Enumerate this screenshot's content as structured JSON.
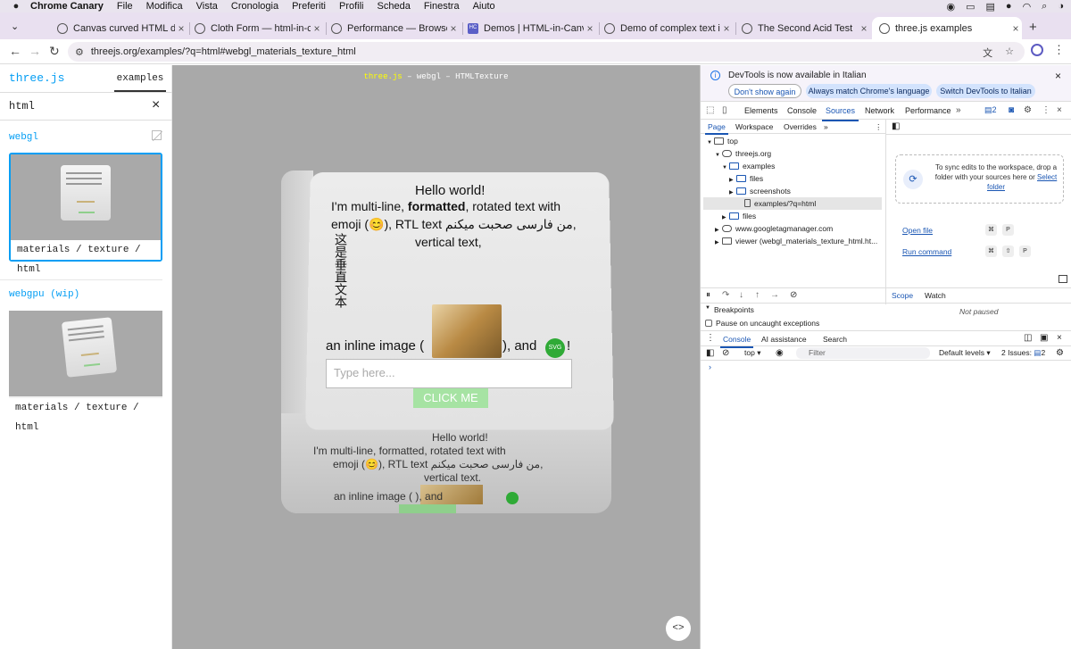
{
  "menubar": {
    "app": "Chrome Canary",
    "items": [
      "File",
      "Modifica",
      "Vista",
      "Cronologia",
      "Preferiti",
      "Profili",
      "Scheda",
      "Finestra",
      "Aiuto"
    ]
  },
  "tabs": [
    {
      "title": "Canvas curved HTML demo",
      "icon": "globe-icon"
    },
    {
      "title": "Cloth Form — html-in-canvas",
      "icon": "globe-icon"
    },
    {
      "title": "Performance — Browser Native",
      "icon": "globe-icon"
    },
    {
      "title": "Demos | HTML-in-Canvas",
      "icon": "hc-icon",
      "icon_text": "HC"
    },
    {
      "title": "Demo of complex text in canvas",
      "icon": "globe-icon"
    },
    {
      "title": "The Second Acid Test",
      "icon": "globe-icon"
    },
    {
      "title": "three.js examples",
      "icon": "globe-icon",
      "active": true
    }
  ],
  "address_bar": {
    "url": "threejs.org/examples/?q=html#webgl_materials_texture_html"
  },
  "sidebar": {
    "logo": "three.js",
    "tab_label": "examples",
    "search_value": "html",
    "categories": [
      {
        "name": "webgl",
        "example": "materials / texture / html",
        "selected": true
      },
      {
        "name": "webgpu (wip)",
        "example": "materials / texture / html",
        "selected": false
      }
    ]
  },
  "viewport": {
    "title_link": "three.js",
    "title_rest": " – webgl – HTMLTexture",
    "face": {
      "hello": "Hello world!",
      "line1_a": "I'm multi-line, ",
      "line1_b": "formatted",
      "line1_c": ", rotated text with",
      "line2": "emoji (😊), RTL text من فارسی صحبت میکنم,",
      "line3": "vertical text,",
      "vertical": "这是垂直文本",
      "inline_a": "an inline image (",
      "inline_b": "), and",
      "inline_c": "!",
      "svg_badge": "SVG",
      "input_placeholder": "Type here...",
      "button": "CLICK ME"
    },
    "bottom_face": {
      "hello": "Hello world!",
      "line1": "I'm multi-line, formatted, rotated text with",
      "line2": "emoji (😊), RTL text من فارسی صحبت میکنم,",
      "line3": "vertical text.",
      "inline": "an inline image (            ), and"
    },
    "code_button": "<>"
  },
  "devtools": {
    "info_message": "DevTools is now available in Italian",
    "info_buttons": [
      "Don't show again",
      "Always match Chrome's language",
      "Switch DevTools to Italian"
    ],
    "tabs": [
      "Elements",
      "Console",
      "Sources",
      "Network",
      "Performance"
    ],
    "active_tab": "Sources",
    "issues_badge": "2",
    "sub_tabs": [
      "Page",
      "Workspace",
      "Overrides"
    ],
    "tree": [
      {
        "label": "top",
        "depth": 0,
        "icon": "frame",
        "arrow": "▼"
      },
      {
        "label": "threejs.org",
        "depth": 1,
        "icon": "cloud",
        "arrow": "▼"
      },
      {
        "label": "examples",
        "depth": 2,
        "icon": "folder",
        "arrow": "▼"
      },
      {
        "label": "files",
        "depth": 3,
        "icon": "folder",
        "arrow": "▶"
      },
      {
        "label": "screenshots",
        "depth": 3,
        "icon": "folder",
        "arrow": "▶"
      },
      {
        "label": "examples/?q=html",
        "depth": 3,
        "icon": "file",
        "arrow": "",
        "selected": true
      },
      {
        "label": "files",
        "depth": 2,
        "icon": "folder",
        "arrow": "▶"
      },
      {
        "label": "www.googletagmanager.com",
        "depth": 1,
        "icon": "cloud",
        "arrow": "▶"
      },
      {
        "label": "viewer (webgl_materials_texture_html.ht...",
        "depth": 1,
        "icon": "frame",
        "arrow": "▶"
      }
    ],
    "workspace": {
      "text": "To sync edits to the workspace, drop a folder with your sources here or",
      "link": "Select folder"
    },
    "commands": [
      {
        "label": "Open file",
        "keys": [
          "⌘",
          "P"
        ]
      },
      {
        "label": "Run command",
        "keys": [
          "⌘",
          "⇧",
          "P"
        ]
      }
    ],
    "scope_tab": "Scope",
    "watch_tab": "Watch",
    "breakpoints": "Breakpoints",
    "pause_exceptions": "Pause on uncaught exceptions",
    "not_paused": "Not paused",
    "drawer_tabs": [
      "Console",
      "AI assistance",
      "Search"
    ],
    "console_context": "top",
    "filter_placeholder": "Filter",
    "levels": "Default levels",
    "issues_label": "2 Issues:",
    "issues_count": "2",
    "prompt": "›"
  }
}
